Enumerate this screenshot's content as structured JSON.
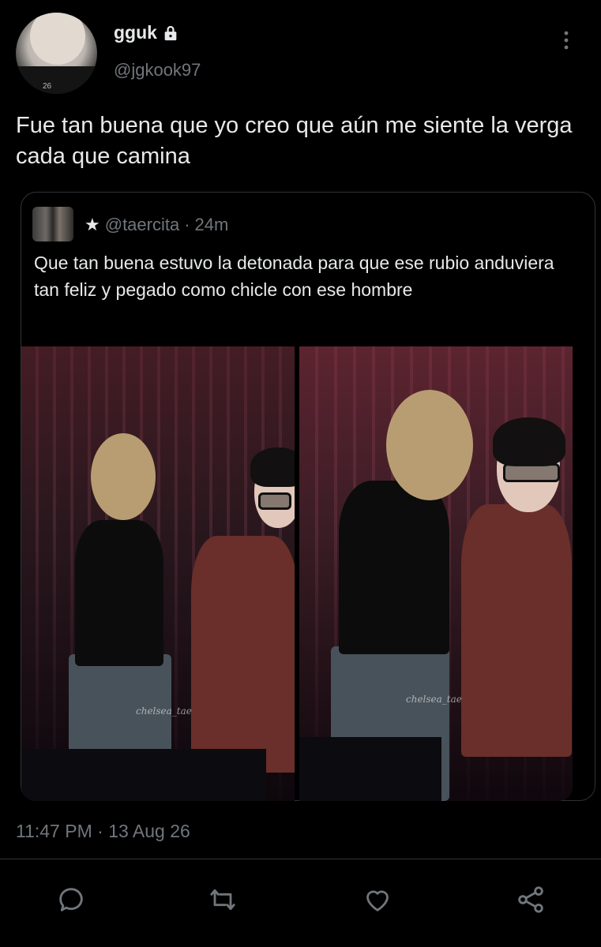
{
  "author": {
    "display_name": "gguk",
    "handle": "@jgkook97",
    "avatar_text": "26"
  },
  "tweet": {
    "text": "Fue tan buena que yo creo que aún me siente la verga cada que camina",
    "time": "11:47 PM",
    "separator": " · ",
    "date": "13 Aug 26"
  },
  "quote": {
    "star": "★",
    "handle": "@taercita",
    "separator": " · ",
    "age": "24m",
    "text": "Que tan buena estuvo la detonada para que ese rubio anduviera tan feliz y pegado como chicle con ese hombre",
    "watermark_left": "chelsea_tae",
    "watermark_right": "chelsea_tae"
  },
  "icons": {
    "lock": "lock-icon",
    "more": "more-vertical-icon",
    "reply": "reply-icon",
    "retweet": "retweet-icon",
    "like": "heart-icon",
    "share": "share-icon"
  },
  "colors": {
    "background": "#000000",
    "text": "#e7e9ea",
    "muted": "#71767b",
    "border": "#2f3336"
  }
}
